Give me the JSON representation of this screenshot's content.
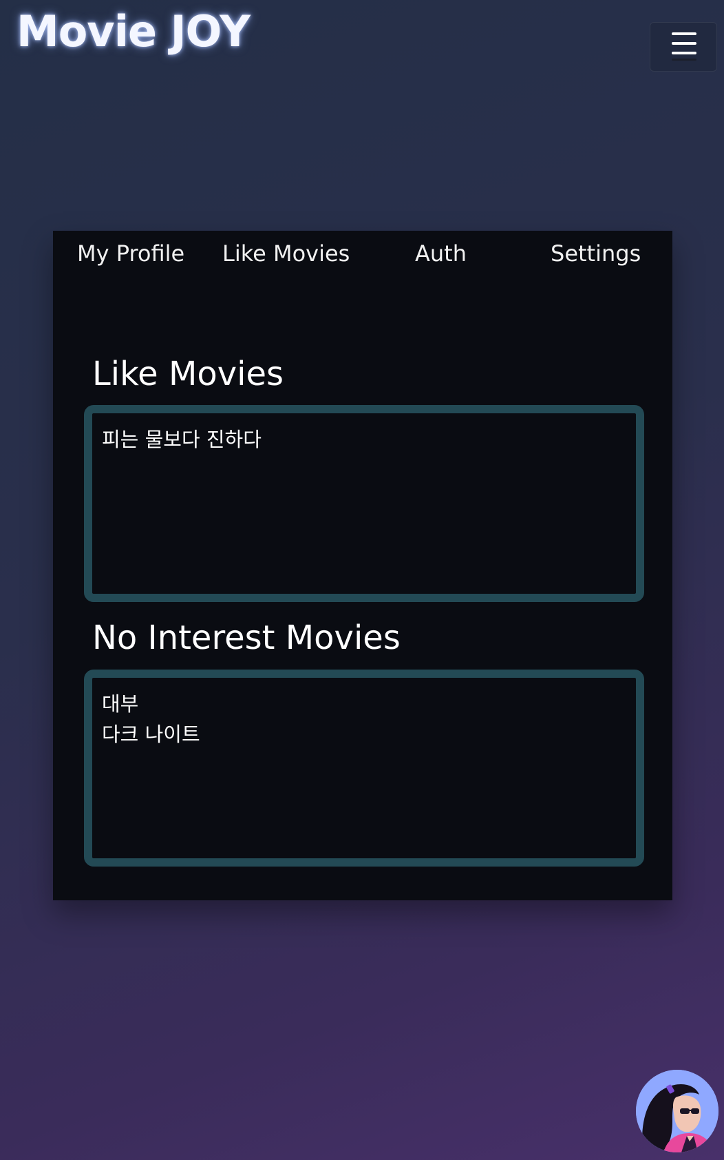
{
  "header": {
    "logo_text": "Movie JOY",
    "menu_icon": "hamburger-menu-icon"
  },
  "tabs": [
    {
      "label": "My Profile"
    },
    {
      "label": "Like Movies"
    },
    {
      "label": "Auth"
    },
    {
      "label": "Settings"
    }
  ],
  "sections": {
    "like": {
      "title": "Like Movies",
      "movies": [
        "피는 물보다 진하다"
      ]
    },
    "no_interest": {
      "title": "No Interest Movies",
      "movies": [
        "대부",
        "다크 나이트"
      ]
    }
  },
  "colors": {
    "accent_border": "#234a55",
    "card_background": "#0a0c12",
    "background_start": "#242f47",
    "background_end": "#48306a"
  }
}
